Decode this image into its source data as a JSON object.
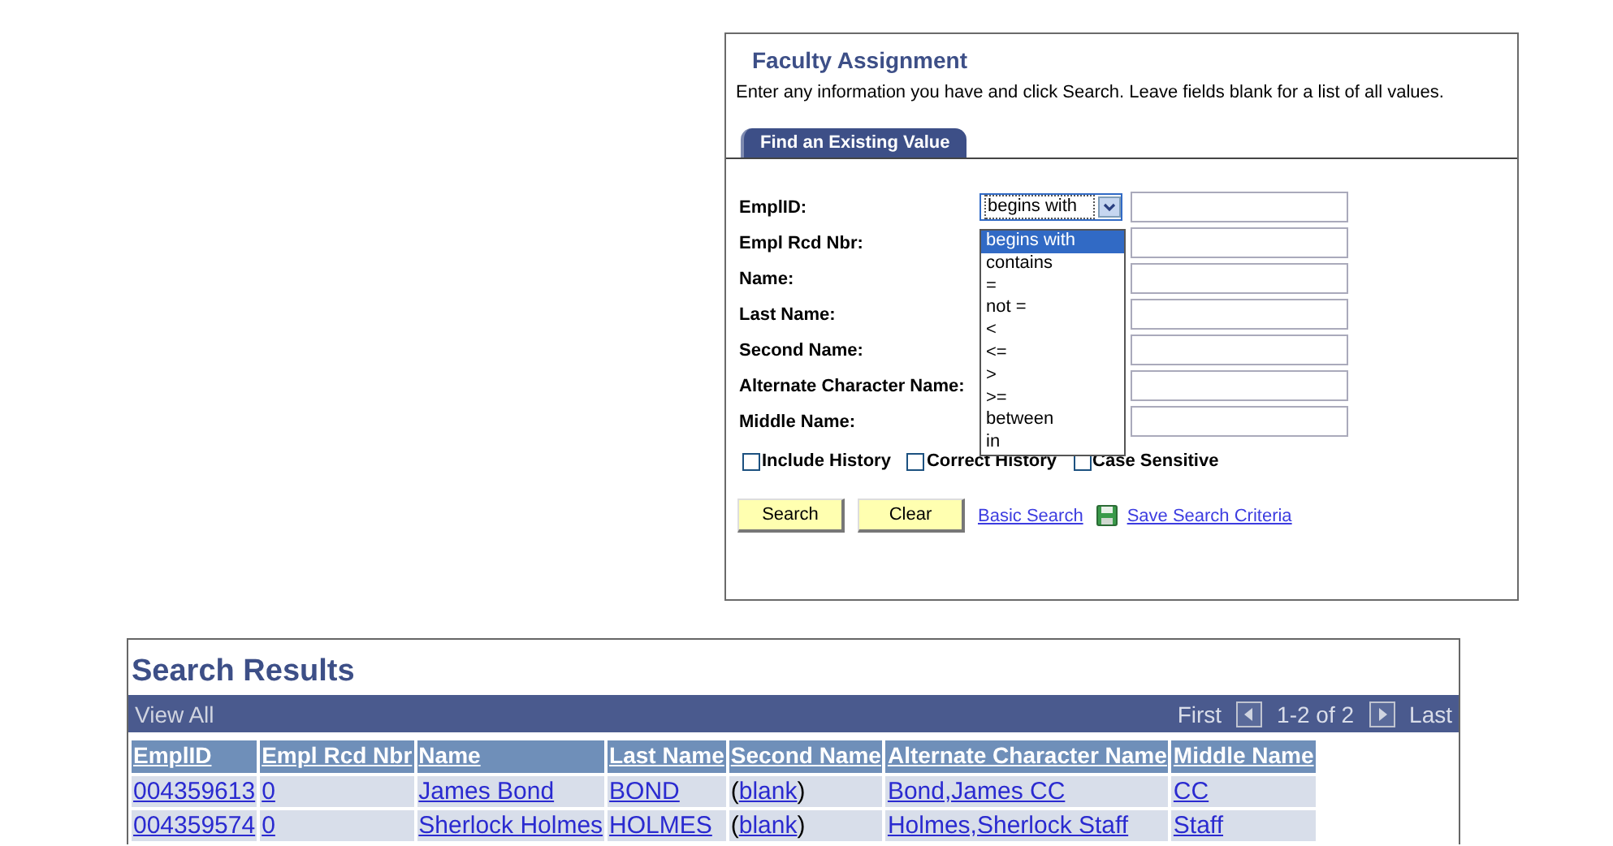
{
  "search_page": {
    "title": "Faculty Assignment",
    "instructions": "Enter any information you have and click Search. Leave fields blank for a list of all values.",
    "tabs": [
      {
        "label": "Find an Existing Value",
        "selected": true
      }
    ],
    "fields": [
      {
        "label": "EmplID:",
        "operator": "begins with",
        "expanded": true
      },
      {
        "label": "Empl Rcd Nbr:"
      },
      {
        "label": "Name:"
      },
      {
        "label": "Last Name:"
      },
      {
        "label": "Second Name:"
      },
      {
        "label": "Alternate Character Name:"
      },
      {
        "label": "Middle Name:"
      }
    ],
    "operator_options": [
      {
        "label": "begins with",
        "selected": true
      },
      {
        "label": "contains",
        "selected": false
      },
      {
        "label": "=",
        "selected": false
      },
      {
        "label": "not =",
        "selected": false
      },
      {
        "label": "<",
        "selected": false
      },
      {
        "label": "<=",
        "selected": false
      },
      {
        "label": ">",
        "selected": false
      },
      {
        "label": ">=",
        "selected": false
      },
      {
        "label": "between",
        "selected": false
      },
      {
        "label": "in",
        "selected": false
      }
    ],
    "checkboxes": [
      {
        "label": "Include History",
        "checked": false
      },
      {
        "label": "Correct History",
        "checked": false
      },
      {
        "label": "Case Sensitive",
        "checked": false
      }
    ],
    "buttons": [
      "Search",
      "Clear"
    ],
    "links": [
      {
        "label": "Basic Search",
        "kind": "plain"
      },
      {
        "label": "Save Search Criteria",
        "kind": "save"
      }
    ]
  },
  "search_results": {
    "title": "Search Results",
    "view_all": "View All",
    "first": "First",
    "range": "1-2 of 2",
    "last": "Last",
    "columns": [
      "EmplID",
      "Empl Rcd Nbr",
      "Name",
      "Last Name",
      "Second Name",
      "Alternate Character Name",
      "Middle Name"
    ],
    "rows": [
      [
        {
          "text": "004359613"
        },
        {
          "text": "0"
        },
        {
          "text": "James Bond"
        },
        {
          "text": "BOND"
        },
        {
          "prefix": "(",
          "text": "blank",
          "suffix": ")"
        },
        {
          "text": "Bond,James CC"
        },
        {
          "text": "CC"
        }
      ],
      [
        {
          "text": "004359574"
        },
        {
          "text": "0"
        },
        {
          "text": "Sherlock Holmes"
        },
        {
          "text": "HOLMES"
        },
        {
          "prefix": "(",
          "text": "blank",
          "suffix": ")"
        },
        {
          "text": "Holmes,Sherlock Staff"
        },
        {
          "text": "Staff"
        }
      ]
    ]
  }
}
